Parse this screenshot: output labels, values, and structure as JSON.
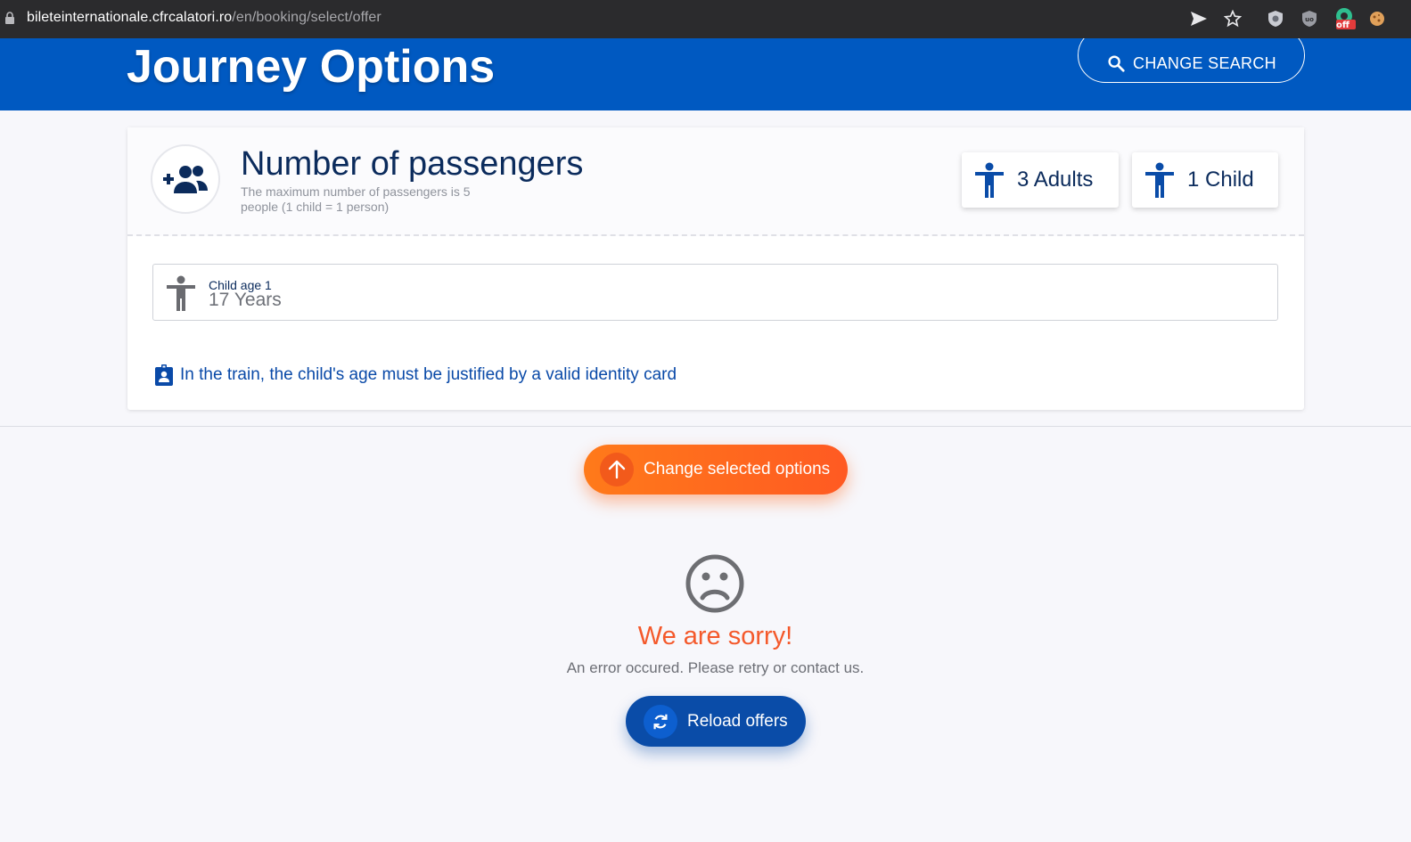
{
  "browser": {
    "url_domain": "bileteinternationale.cfrcalatori.ro",
    "url_path": "/en/booking/select/offer",
    "extension_badge": "off",
    "icons": [
      "lock-icon",
      "send-icon",
      "star-icon",
      "shield-extension-icon",
      "ublock-icon",
      "vpn-extension-icon",
      "cookie-extension-icon"
    ]
  },
  "header": {
    "title": "Journey Options",
    "change_search_label": "CHANGE SEARCH"
  },
  "passengers": {
    "title": "Number of passengers",
    "subtitle": "The maximum number of passengers is 5 people (1 child = 1 person)",
    "adults_label": "3 Adults",
    "child_label": "1 Child",
    "child_age_label": "Child age 1",
    "child_age_value": "17 Years",
    "id_note": "In the train, the child's age must be justified by a valid identity card"
  },
  "actions": {
    "change_options_label": "Change selected options",
    "reload_label": "Reload offers"
  },
  "error": {
    "title": "We are sorry!",
    "message": "An error occured. Please retry or contact us."
  },
  "colors": {
    "brand_blue": "#0059c1",
    "navy_text": "#0b2b5c",
    "orange_accent": "#ff6a1f",
    "error_orange": "#f4592b",
    "reload_blue": "#0a4ca8"
  }
}
